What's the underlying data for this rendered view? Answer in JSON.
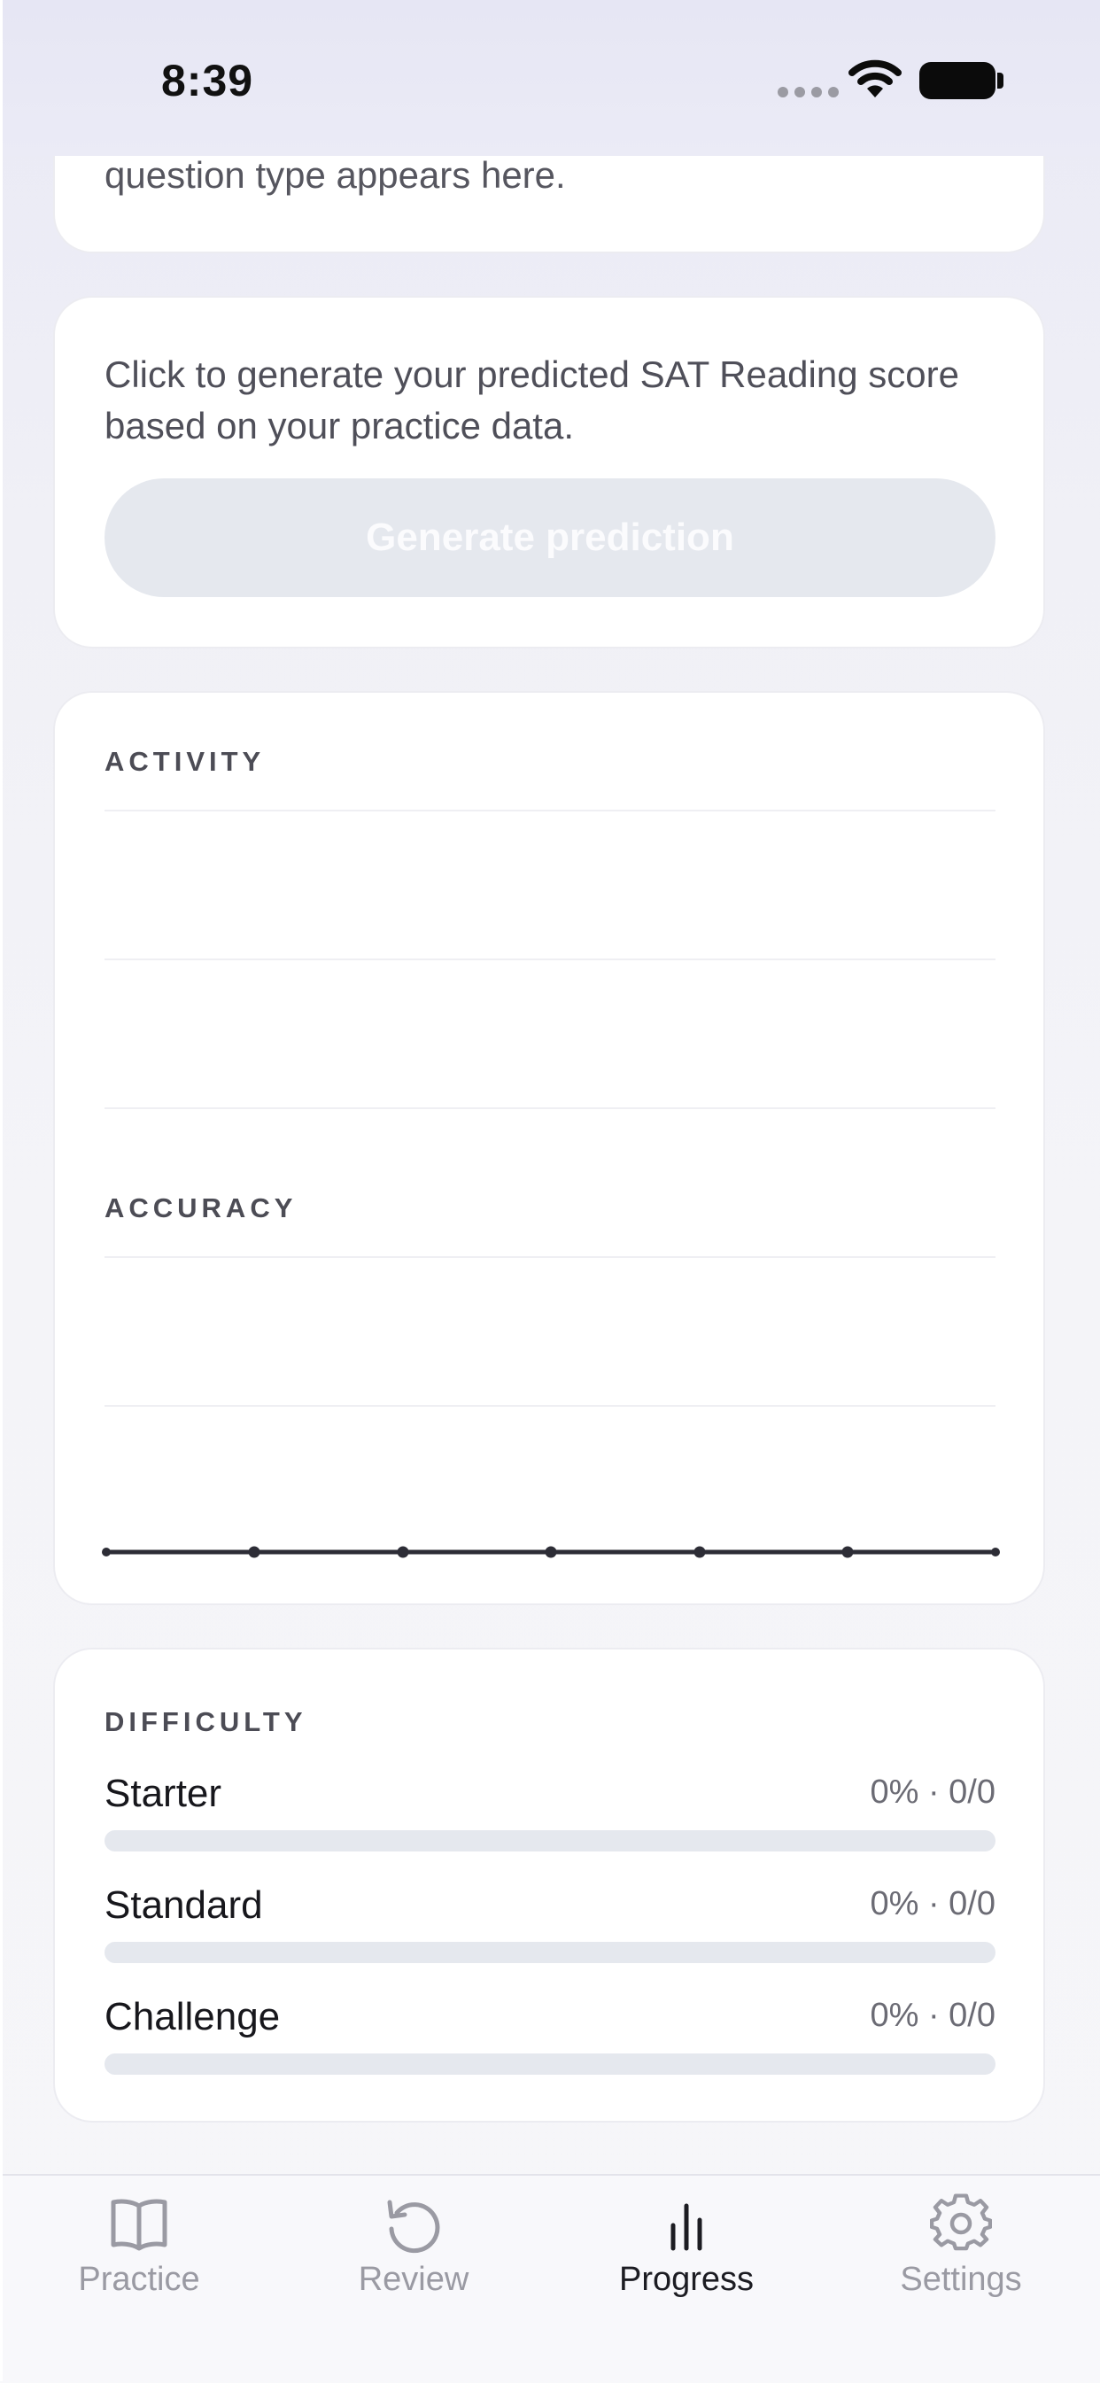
{
  "status_bar": {
    "time": "8:39"
  },
  "intro_card": {
    "text": "question type appears here."
  },
  "prediction": {
    "description": "Click to generate your predicted SAT Reading score based on your practice data.",
    "button_label": "Generate prediction"
  },
  "activity": {
    "label": "ACTIVITY"
  },
  "accuracy": {
    "label": "ACCURACY"
  },
  "difficulty": {
    "label": "DIFFICULTY",
    "rows": [
      {
        "name": "Starter",
        "stat": "0% · 0/0",
        "progress": 0
      },
      {
        "name": "Standard",
        "stat": "0% · 0/0",
        "progress": 0
      },
      {
        "name": "Challenge",
        "stat": "0% · 0/0",
        "progress": 0
      }
    ]
  },
  "tabs": [
    {
      "label": "Practice",
      "icon": "book-icon",
      "active": false
    },
    {
      "label": "Review",
      "icon": "history-icon",
      "active": false
    },
    {
      "label": "Progress",
      "icon": "bar-chart-icon",
      "active": true
    },
    {
      "label": "Settings",
      "icon": "gear-icon",
      "active": false
    }
  ],
  "colors": {
    "accent": "#1c1c22",
    "inactive": "#9a9aa3",
    "button_disabled": "#e5e8ee"
  }
}
